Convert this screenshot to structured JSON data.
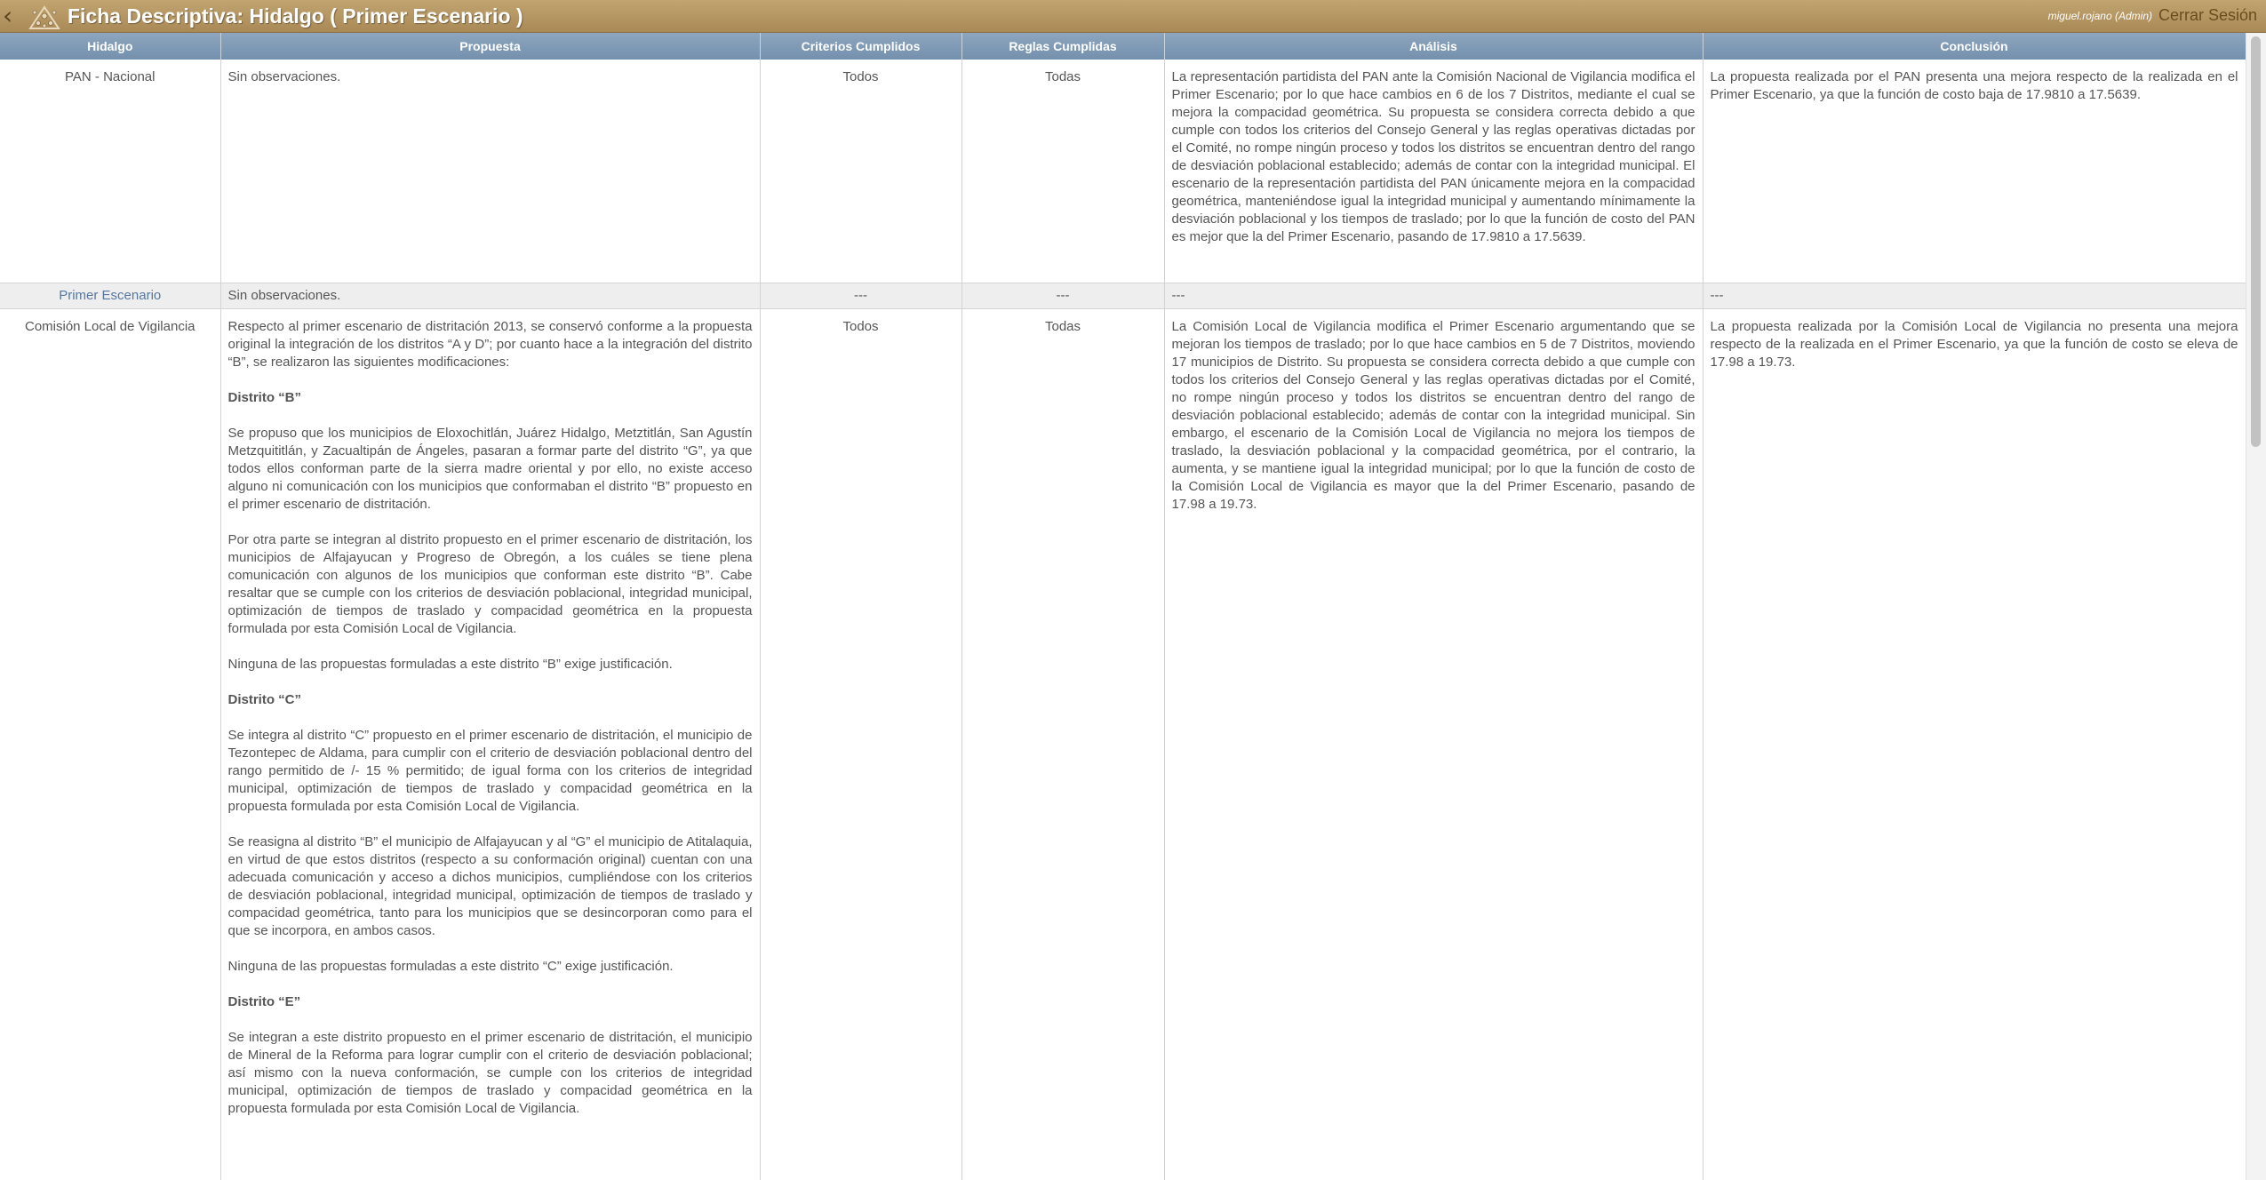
{
  "header": {
    "title": "Ficha Descriptiva: Hidalgo ( Primer Escenario )",
    "user": "miguel.rojano (Admin)",
    "logout": "Cerrar Sesión",
    "back_icon": "chevron-left-icon",
    "logo_icon": "institution-logo-icon",
    "bar_color": "#b09460"
  },
  "table": {
    "columns": [
      "Hidalgo",
      "Propuesta",
      "Criterios Cumplidos",
      "Reglas Cumplidas",
      "Análisis",
      "Conclusión"
    ],
    "header_color": "#7f9ab6",
    "rows": [
      {
        "entity": "PAN - Nacional",
        "propuesta": [
          "Sin observaciones."
        ],
        "criterios": "Todos",
        "reglas": "Todas",
        "analisis": "La representación partidista del PAN ante la Comisión Nacional de Vigilancia modifica el Primer Escenario; por lo que hace cambios en 6 de los 7 Distritos, mediante el cual se mejora la compacidad geométrica. Su propuesta se considera correcta debido a que cumple con todos los criterios del Consejo General y las reglas operativas dictadas por el Comité, no rompe ningún proceso y todos los distritos se encuentran dentro del rango de desviación poblacional establecido; además de contar con la integridad municipal. El escenario de la representación partidista del PAN únicamente mejora en la compacidad geométrica, manteniéndose igual la integridad municipal y aumentando mínimamente la desviación poblacional y los tiempos de traslado; por lo que la función de costo del PAN es mejor que la del Primer Escenario, pasando de 17.9810 a 17.5639.",
        "conclusion": "La propuesta realizada por el PAN presenta una mejora respecto de la realizada en el Primer Escenario, ya que la función de costo baja de 17.9810 a 17.5639."
      },
      {
        "entity": "Primer Escenario",
        "propuesta": [
          "Sin observaciones."
        ],
        "criterios": "---",
        "reglas": "---",
        "analisis": "---",
        "conclusion": "---"
      },
      {
        "entity": "Comisión Local de Vigilancia",
        "propuesta": [
          "Respecto al primer escenario de distritación 2013, se conservó conforme a la propuesta original la integración de los distritos “A y D”; por cuanto hace a la integración del distrito “B”, se realizaron las siguientes modificaciones:",
          "Distrito “B”",
          "Se propuso que los municipios de Eloxochitlán, Juárez Hidalgo, Metztitlán, San Agustín Metzquititlán, y Zacualtipán de Ángeles, pasaran a formar parte del distrito “G”, ya que todos ellos conforman parte de la sierra madre oriental y por ello, no existe acceso alguno ni comunicación con los municipios que conformaban el distrito “B” propuesto en el primer escenario de distritación.",
          "Por otra parte se integran al distrito propuesto en el primer escenario de distritación, los municipios de Alfajayucan y Progreso de Obregón, a los cuáles se tiene plena comunicación con algunos de los municipios que conforman este distrito “B”. Cabe resaltar que se cumple con los criterios de desviación poblacional, integridad municipal, optimización de tiempos de traslado y compacidad geométrica en la propuesta formulada por esta Comisión Local de Vigilancia.",
          "Ninguna de las propuestas formuladas a este distrito “B” exige justificación.",
          "Distrito “C”",
          "Se integra al distrito “C” propuesto en el primer escenario de distritación, el municipio de Tezontepec de Aldama, para cumplir con el criterio de desviación poblacional dentro del rango permitido de /- 15 % permitido; de igual forma con los criterios de integridad municipal, optimización de tiempos de traslado y compacidad geométrica en la propuesta formulada por esta Comisión Local de Vigilancia.",
          "Se reasigna al distrito “B” el municipio de Alfajayucan y al “G” el municipio de Atitalaquia, en virtud de que estos distritos (respecto a su conformación original) cuentan con una adecuada comunicación y acceso a dichos municipios, cumpliéndose con los criterios de desviación poblacional, integridad municipal, optimización de tiempos de traslado y compacidad geométrica, tanto para los municipios que se desincorporan como para el que se incorpora, en ambos casos.",
          "Ninguna de las propuestas formuladas a este distrito “C” exige justificación.",
          "Distrito “E”",
          "Se integran a este distrito propuesto en el primer escenario de distritación, el municipio de Mineral de la Reforma para lograr cumplir con el criterio de desviación poblacional; así mismo con la nueva conformación, se cumple con los criterios de integridad municipal, optimización de tiempos de traslado y compacidad geométrica en la propuesta formulada por esta Comisión Local de Vigilancia."
        ],
        "criterios": "Todos",
        "reglas": "Todas",
        "analisis": "La Comisión Local de Vigilancia modifica el Primer Escenario argumentando que se mejoran los tiempos de traslado; por lo que hace cambios en 5 de 7 Distritos, moviendo 17 municipios de Distrito. Su propuesta se considera correcta debido a que cumple con todos los criterios del Consejo General y las reglas operativas dictadas por el Comité, no rompe ningún proceso y todos los distritos se encuentran dentro del rango de desviación poblacional establecido; además de contar con la integridad municipal. Sin embargo, el escenario de la Comisión Local de Vigilancia no mejora los tiempos de traslado, la desviación poblacional y la compacidad geométrica, por el contrario, la aumenta, y se mantiene igual la integridad municipal; por lo que la función de costo de la Comisión Local de Vigilancia es mayor que la del Primer Escenario, pasando de 17.98 a 19.73.",
        "conclusion": "La propuesta realizada por la Comisión Local de Vigilancia no presenta una mejora respecto de la realizada en el Primer Escenario, ya que la función de costo se eleva de 17.98 a 19.73."
      }
    ]
  }
}
